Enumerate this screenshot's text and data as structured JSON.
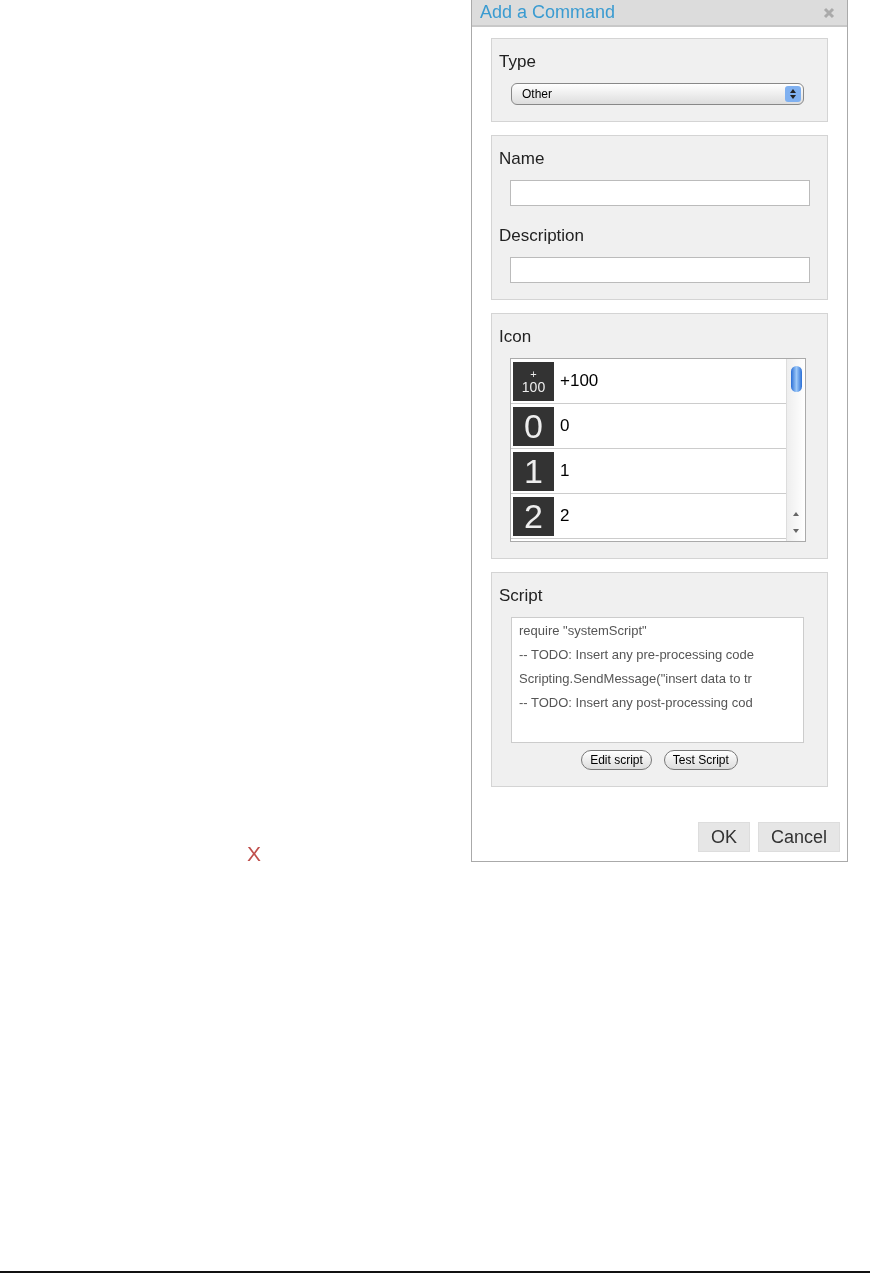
{
  "stray_mark": "X",
  "dialog": {
    "title": "Add a Command",
    "type": {
      "label": "Type",
      "value": "Other"
    },
    "name": {
      "label": "Name"
    },
    "description": {
      "label": "Description"
    },
    "icon": {
      "label": "Icon",
      "items": [
        {
          "tile_top": "+",
          "tile": "100",
          "label": "+100"
        },
        {
          "tile": "0",
          "label": "0"
        },
        {
          "tile": "1",
          "label": "1"
        },
        {
          "tile": "2",
          "label": "2"
        }
      ]
    },
    "script": {
      "label": "Script",
      "lines": [
        "require \"systemScript\"",
        "-- TODO: Insert any pre-processing code",
        "Scripting.SendMessage(\"insert data to tr",
        "-- TODO: Insert any post-processing cod"
      ],
      "buttons": [
        "Edit script",
        "Test Script"
      ]
    },
    "buttons": [
      "OK",
      "Cancel"
    ]
  }
}
